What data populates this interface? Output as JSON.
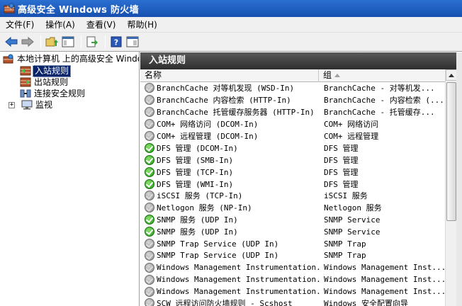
{
  "window": {
    "title": "高级安全 Windows 防火墙"
  },
  "menu": [
    {
      "label": "文件(F)"
    },
    {
      "label": "操作(A)"
    },
    {
      "label": "查看(V)"
    },
    {
      "label": "帮助(H)"
    }
  ],
  "toolbar": {
    "buttons": [
      "back-arrow-icon",
      "forward-arrow-icon",
      "up-folder-icon",
      "show-hide-tree-icon",
      "export-list-icon",
      "help-icon",
      "show-hide-action-pane-icon"
    ]
  },
  "tree": {
    "root": "本地计算机 上的高级安全 Windows",
    "items": [
      {
        "label": "入站规则"
      },
      {
        "label": "出站规则"
      },
      {
        "label": "连接安全规则"
      },
      {
        "label": "监视"
      }
    ]
  },
  "pane": {
    "title": "入站规则",
    "columns": {
      "name": "名称",
      "group": "组"
    },
    "rows": [
      {
        "status": "disabled",
        "name": "BranchCache 对等机发现 (WSD-In)",
        "group": "BranchCache - 对等机发..."
      },
      {
        "status": "disabled",
        "name": "BranchCache 内容检索 (HTTP-In)",
        "group": "BranchCache - 内容检索 (..."
      },
      {
        "status": "disabled",
        "name": "BranchCache 托管缓存服务器 (HTTP-In)",
        "group": "BranchCache - 托管缓存..."
      },
      {
        "status": "disabled",
        "name": "COM+ 网络访问 (DCOM-In)",
        "group": "COM+ 网络访问"
      },
      {
        "status": "disabled",
        "name": "COM+ 远程管理 (DCOM-In)",
        "group": "COM+ 远程管理"
      },
      {
        "status": "enabled",
        "name": "DFS 管理 (DCOM-In)",
        "group": "DFS 管理"
      },
      {
        "status": "enabled",
        "name": "DFS 管理 (SMB-In)",
        "group": "DFS 管理"
      },
      {
        "status": "enabled",
        "name": "DFS 管理 (TCP-In)",
        "group": "DFS 管理"
      },
      {
        "status": "enabled",
        "name": "DFS 管理 (WMI-In)",
        "group": "DFS 管理"
      },
      {
        "status": "disabled",
        "name": "iSCSI 服务 (TCP-In)",
        "group": "iSCSI 服务"
      },
      {
        "status": "disabled",
        "name": "Netlogon 服务 (NP-In)",
        "group": "Netlogon 服务"
      },
      {
        "status": "enabled",
        "name": "SNMP 服务 (UDP In)",
        "group": "SNMP Service"
      },
      {
        "status": "enabled",
        "name": "SNMP 服务 (UDP In)",
        "group": "SNMP Service"
      },
      {
        "status": "disabled",
        "name": "SNMP Trap Service (UDP In)",
        "group": "SNMP Trap"
      },
      {
        "status": "disabled",
        "name": "SNMP Trap Service (UDP In)",
        "group": "SNMP Trap"
      },
      {
        "status": "disabled",
        "name": "Windows Management Instrumentation...",
        "group": "Windows Management Inst..."
      },
      {
        "status": "disabled",
        "name": "Windows Management Instrumentation...",
        "group": "Windows Management Inst..."
      },
      {
        "status": "disabled",
        "name": "Windows Management Instrumentation...",
        "group": "Windows Management Inst..."
      },
      {
        "status": "disabled",
        "name": "SCW 远程访问防火墙规则 - Scshost",
        "group": "Windows 安全配置向导"
      }
    ]
  }
}
